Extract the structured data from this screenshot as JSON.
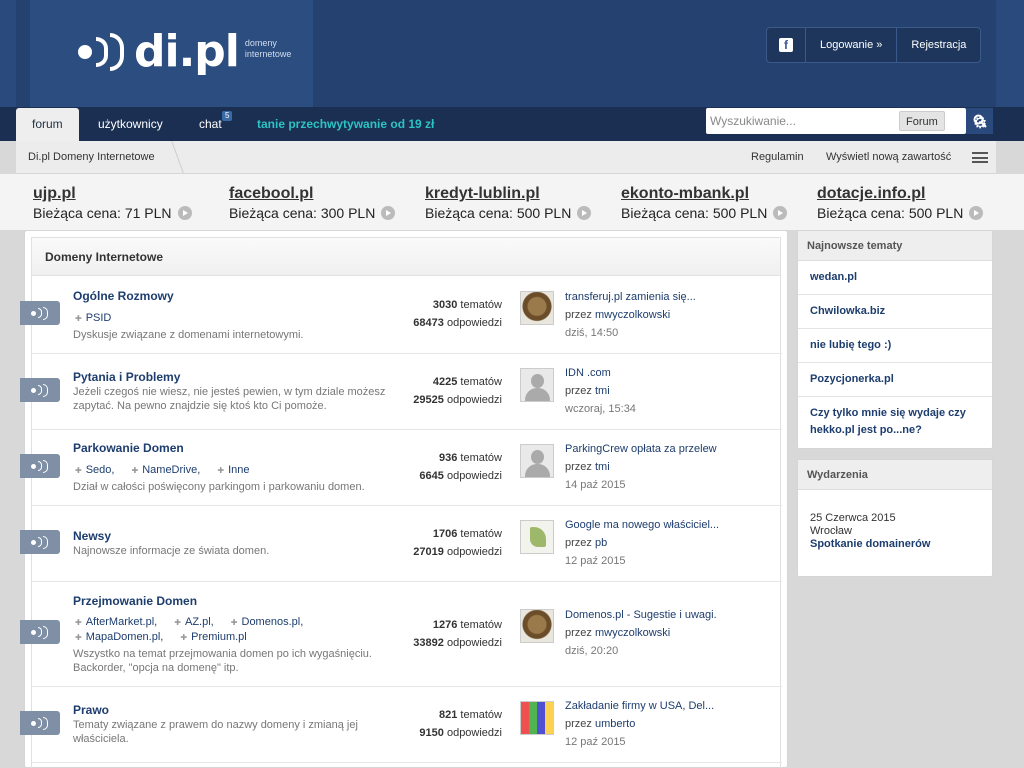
{
  "logo": {
    "text": "di.pl",
    "sub1": "domeny",
    "sub2": "internetowe"
  },
  "auth": {
    "fb_glyph": "f",
    "login": "Logowanie »",
    "register": "Rejestracja"
  },
  "nav": {
    "tabs": [
      "forum",
      "użytkownicy",
      "chat"
    ],
    "chat_badge": "5",
    "promo": "tanie przechwytywanie od 19 zł",
    "search_placeholder": "Wyszukiwanie...",
    "search_scope": "Forum"
  },
  "breadcrumb": {
    "home": "Di.pl Domeny Internetowe",
    "rules": "Regulamin",
    "new_content": "Wyświetl nową zawartość"
  },
  "ads": [
    {
      "name": "ujp.pl",
      "price": "Bieżąca cena: 71 PLN"
    },
    {
      "name": "facebool.pl",
      "price": "Bieżąca cena: 300 PLN"
    },
    {
      "name": "kredyt-lublin.pl",
      "price": "Bieżąca cena: 500 PLN"
    },
    {
      "name": "ekonto-mbank.pl",
      "price": "Bieżąca cena: 500 PLN"
    },
    {
      "name": "dotacje.info.pl",
      "price": "Bieżąca cena: 500 PLN"
    }
  ],
  "category": {
    "title": "Domeny Internetowe",
    "forums": [
      {
        "title": "Ogólne Rozmowy",
        "subs": [
          "PSID"
        ],
        "desc": "Dyskusje związane z domenami internetowymi.",
        "topics": "3030",
        "topics_label": "tematów",
        "replies": "68473",
        "replies_label": "odpowiedzi",
        "last_title": "transferuj.pl zamienia się...",
        "last_by": "przez",
        "last_user": "mwyczolkowski",
        "last_date": "dziś, 14:50"
      },
      {
        "title": "Pytania i Problemy",
        "subs": [],
        "desc": "Jeżeli czegoś nie wiesz, nie jesteś pewien, w tym dziale możesz zapytać. Na pewno znajdzie się ktoś kto Ci pomoże.",
        "topics": "4225",
        "topics_label": "tematów",
        "replies": "29525",
        "replies_label": "odpowiedzi",
        "last_title": "IDN .com",
        "last_by": "przez",
        "last_user": "tmi",
        "last_date": "wczoraj, 15:34"
      },
      {
        "title": "Parkowanie Domen",
        "subs": [
          "Sedo,",
          "NameDrive,",
          "Inne"
        ],
        "desc": "Dział w całości poświęcony parkingom i parkowaniu domen.",
        "topics": "936",
        "topics_label": "tematów",
        "replies": "6645",
        "replies_label": "odpowiedzi",
        "last_title": "ParkingCrew opłata za przelew",
        "last_by": "przez",
        "last_user": "tmi",
        "last_date": "14 paź 2015"
      },
      {
        "title": "Newsy",
        "subs": [],
        "desc": "Najnowsze informacje ze świata domen.",
        "topics": "1706",
        "topics_label": "tematów",
        "replies": "27019",
        "replies_label": "odpowiedzi",
        "last_title": "Google ma nowego właściciel...",
        "last_by": "przez",
        "last_user": "pb",
        "last_date": "12 paź 2015"
      },
      {
        "title": "Przejmowanie Domen",
        "subs": [
          "AfterMarket.pl,",
          "AZ.pl,",
          "Domenos.pl,",
          "MapaDomen.pl,",
          "Premium.pl"
        ],
        "desc": "Wszystko na temat przejmowania domen po ich wygaśnięciu. Backorder, \"opcja na domenę\" itp.",
        "topics": "1276",
        "topics_label": "tematów",
        "replies": "33892",
        "replies_label": "odpowiedzi",
        "last_title": "Domenos.pl - Sugestie i uwagi.",
        "last_by": "przez",
        "last_user": "mwyczolkowski",
        "last_date": "dziś, 20:20"
      },
      {
        "title": "Prawo",
        "subs": [],
        "desc": "Tematy związane z prawem do nazwy domeny i zmianą jej właściciela.",
        "topics": "821",
        "topics_label": "tematów",
        "replies": "9150",
        "replies_label": "odpowiedzi",
        "last_title": "Zakładanie firmy w USA, Del...",
        "last_by": "przez",
        "last_user": "umberto",
        "last_date": "12 paź 2015"
      }
    ]
  },
  "sidebar": {
    "latest_title": "Najnowsze tematy",
    "latest": [
      "wedan.pl",
      "Chwilowka.biz",
      "nie lubię tego :)",
      "Pozycjonerka.pl",
      "Czy tylko mnie się wydaje czy hekko.pl jest po...ne?"
    ],
    "events_title": "Wydarzenia",
    "event_date": "25 Czerwca 2015",
    "event_place": "Wrocław",
    "event_name": "Spotkanie domainerów"
  },
  "icons": {
    "search": "search-icon",
    "settings": "gear-icon",
    "view": "list-view-icon",
    "facebook": "facebook-icon",
    "forum": "forum-signal-icon"
  },
  "colors": {
    "header": "#25416f",
    "nav": "#1a2f52",
    "link": "#1d3d6e",
    "promo": "#2cc3c3"
  }
}
